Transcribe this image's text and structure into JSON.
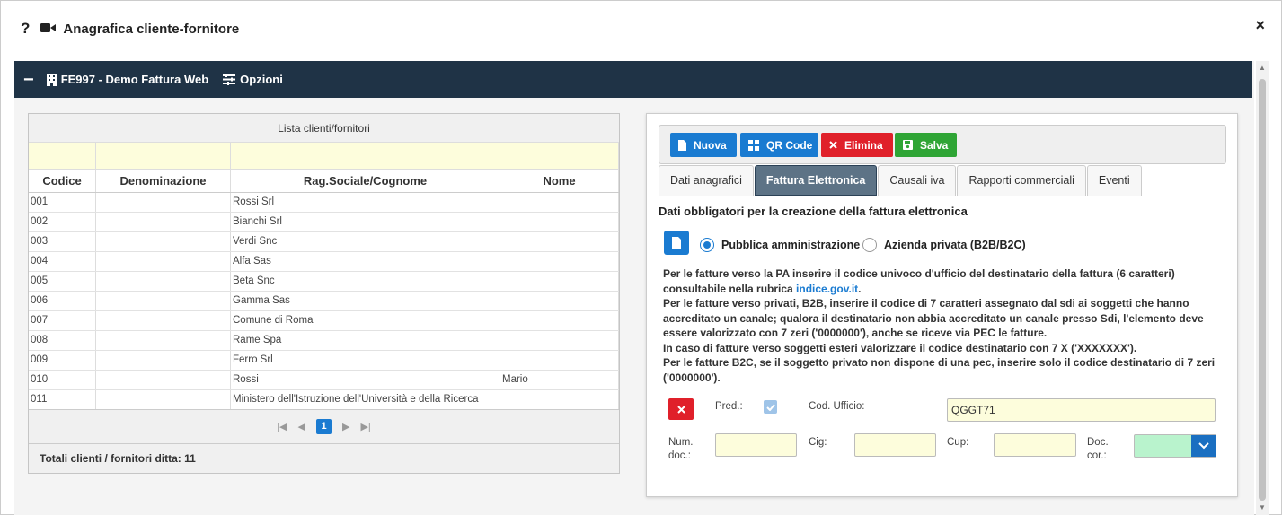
{
  "modal": {
    "help": "?",
    "title": "Anagrafica cliente-fornitore",
    "close": "×"
  },
  "toolbar": {
    "collapse": "−",
    "company": "FE997 - Demo Fattura Web",
    "options": "Opzioni"
  },
  "list": {
    "caption": "Lista clienti/fornitori",
    "columns": [
      "Codice",
      "Denominazione",
      "Rag.Sociale/Cognome",
      "Nome"
    ],
    "rows": [
      [
        "001",
        "",
        "Rossi Srl",
        ""
      ],
      [
        "002",
        "",
        "Bianchi Srl",
        ""
      ],
      [
        "003",
        "",
        "Verdi Snc",
        ""
      ],
      [
        "004",
        "",
        "Alfa Sas",
        ""
      ],
      [
        "005",
        "",
        "Beta Snc",
        ""
      ],
      [
        "006",
        "",
        "Gamma Sas",
        ""
      ],
      [
        "007",
        "",
        "Comune di Roma",
        ""
      ],
      [
        "008",
        "",
        "Rame Spa",
        ""
      ],
      [
        "009",
        "",
        "Ferro Srl",
        ""
      ],
      [
        "010",
        "",
        "Rossi",
        "Mario"
      ],
      [
        "011",
        "",
        "Ministero dell'Istruzione dell'Università e della Ricerca",
        ""
      ]
    ],
    "page": "1",
    "totals": "Totali clienti / fornitori ditta: 11"
  },
  "buttons": {
    "nuova": "Nuova",
    "qr": "QR Code",
    "elimina": "Elimina",
    "salva": "Salva"
  },
  "tabs": [
    "Dati anagrafici",
    "Fattura Elettronica",
    "Causali iva",
    "Rapporti commerciali",
    "Eventi"
  ],
  "active_tab": "Fattura Elettronica",
  "fe": {
    "title": "Dati obbligatori per la creazione della fattura elettronica",
    "radio_pa": "Pubblica amministrazione",
    "radio_b2b": "Azienda privata (B2B/B2C)",
    "selected": "Pubblica amministrazione",
    "info_1": "Per le fatture verso la PA inserire il codice univoco d'ufficio del destinatario della fattura (6 caratteri) consultabile nella rubrica ",
    "info_link": "indice.gov.it",
    "info_1b": ".",
    "info_2": "Per le fatture verso privati, B2B, inserire il codice di 7 caratteri assegnato dal sdi ai soggetti che hanno accreditato un canale; qualora il destinatario non abbia accreditato un canale presso Sdi, l'elemento deve essere valorizzato con 7 zeri ('0000000'), anche se riceve via PEC le fatture.",
    "info_3": "In caso di fatture verso soggetti esteri valorizzare il codice destinatario con 7 X ('XXXXXXX').",
    "info_4": "Per le fatture B2C, se il soggetto privato non dispone di una pec, inserire solo il codice destinatario di 7 zeri ('0000000').",
    "pred_label": "Pred.:",
    "cod_ufficio_label": "Cod. Ufficio:",
    "cod_ufficio_value": "QGGT71",
    "num_doc_label_1": "Num.",
    "num_doc_label_2": "doc.:",
    "cig_label": "Cig:",
    "cup_label": "Cup:",
    "doc_cor_label_1": "Doc.",
    "doc_cor_label_2": "cor.:"
  },
  "colors": {
    "toolbar_bg": "#1f3346",
    "primary": "#1a7bd1",
    "danger": "#e0202a",
    "success": "#2fa535",
    "active_tab": "#5d7386",
    "input_bg": "#fdfddc",
    "select_bg": "#b9f3cd"
  }
}
